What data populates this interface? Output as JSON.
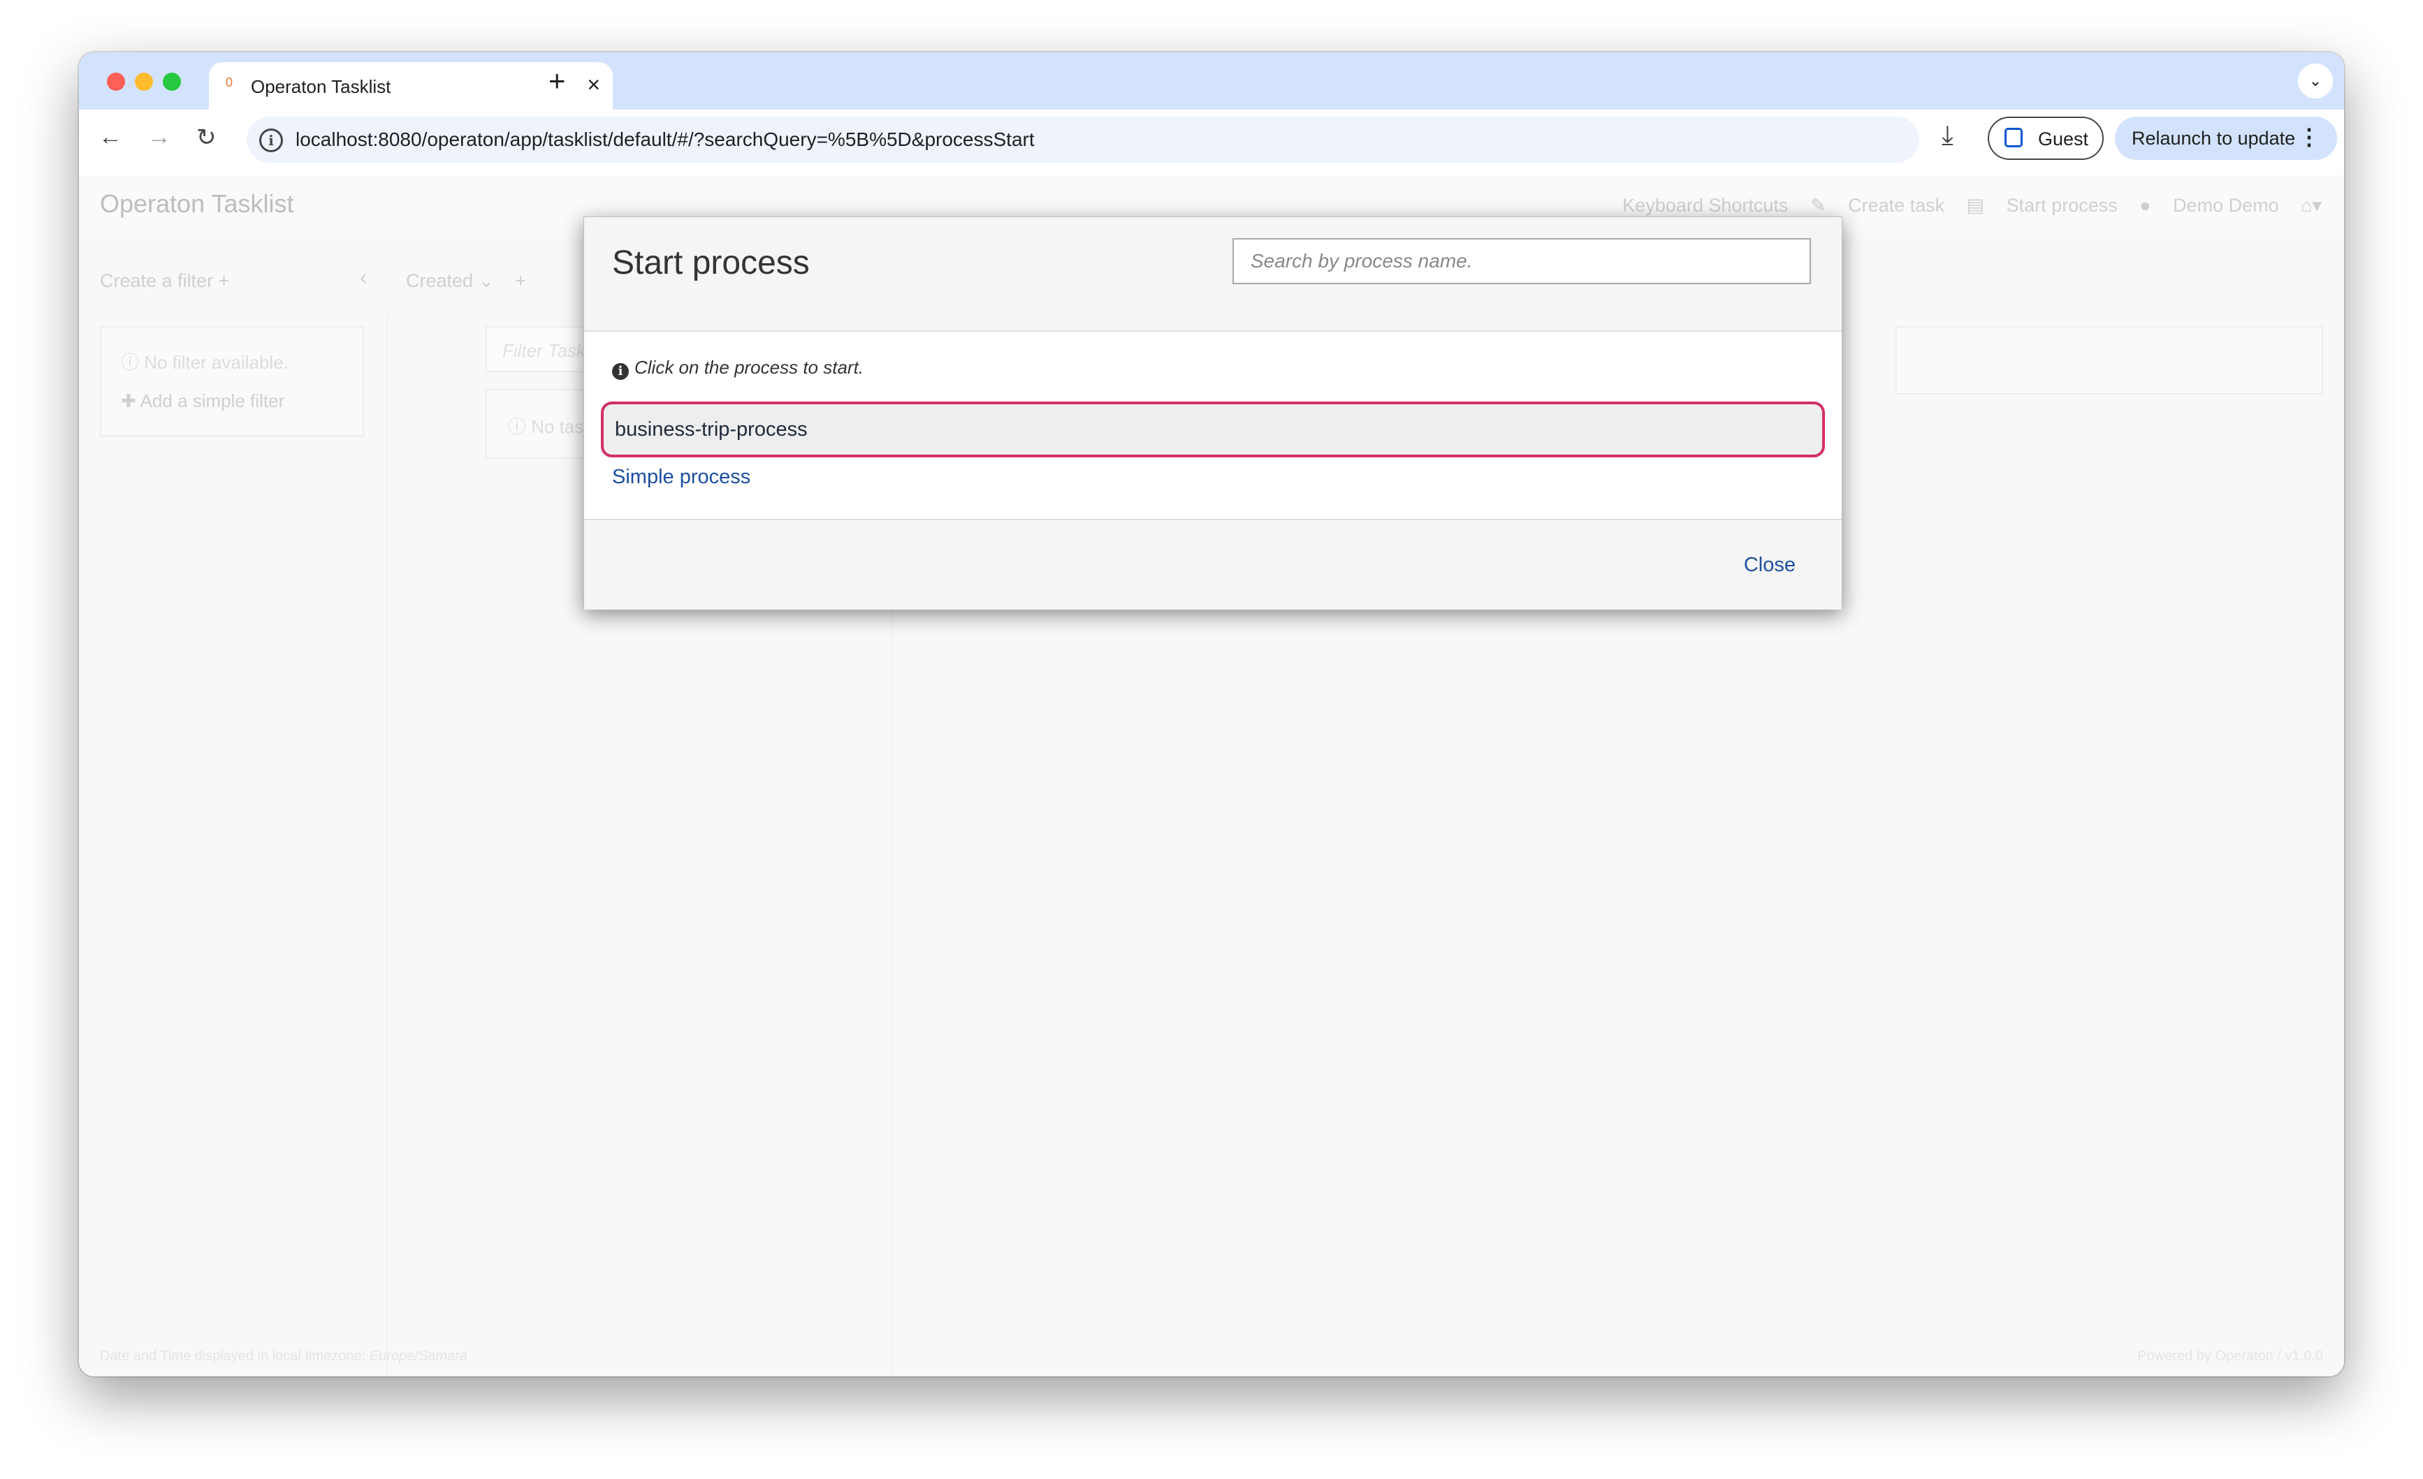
{
  "browser": {
    "tab_title": "Operaton Tasklist",
    "tab_favicon": "0",
    "url": "localhost:8080/operaton/app/tasklist/default/#/?searchQuery=%5B%5D&processStart",
    "guest_label": "Guest",
    "relaunch_label": "Relaunch to update",
    "icons": [
      "back-arrow-icon",
      "forward-arrow-icon",
      "reload-icon",
      "info-icon",
      "download-icon",
      "profile-icon",
      "more-vert-icon"
    ]
  },
  "app": {
    "brand": "Operaton Tasklist",
    "header_links": {
      "shortcuts": "Keyboard Shortcuts",
      "create_task": "Create task",
      "start_process": "Start process",
      "user": "Demo Demo"
    },
    "create_filter": "Create a filter +",
    "sort_label": "Created",
    "no_filter": "No filter available.",
    "add_filter": "Add a simple filter",
    "filter_tasks_placeholder": "Filter Tasks",
    "no_task": "No task matching",
    "footer_left_prefix": "Date and Time displayed in local timezone:",
    "footer_left_tz": "Europe/Samara",
    "footer_right": "Powered by Operaton / v1.0.0"
  },
  "modal": {
    "title": "Start process",
    "search_placeholder": "Search by process name.",
    "hint": "Click on the process to start.",
    "processes": [
      "business-trip-process",
      "Simple process"
    ],
    "close_label": "Close",
    "highlight_color": "#d2306b",
    "link_color": "#1c4fa0"
  }
}
